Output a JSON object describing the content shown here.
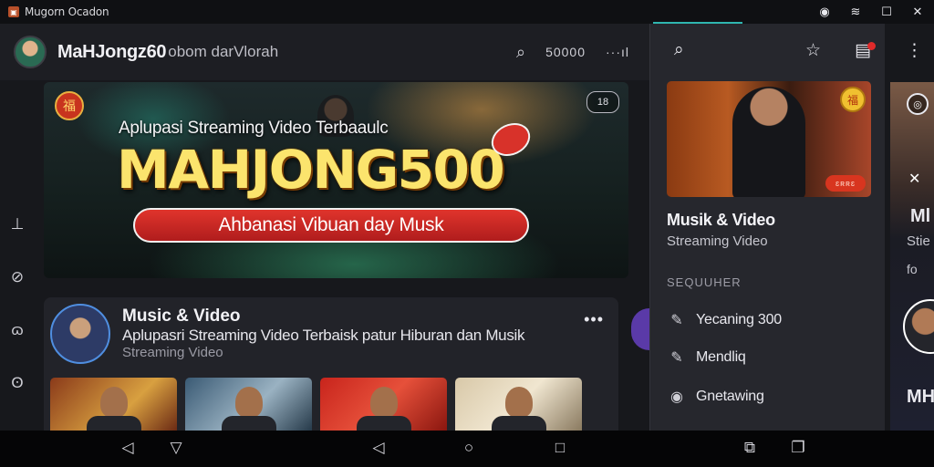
{
  "window": {
    "title": "Mugorn Ocadon",
    "icons": [
      "wifi-icon",
      "signal-icon",
      "maximize-icon",
      "close-icon"
    ]
  },
  "header": {
    "app_name": "MaHJongz60",
    "app_name_suffix": "obom darVlorah",
    "count": "50000",
    "more_label": "···ıl"
  },
  "hero": {
    "tagline": "Aplupasi Streaming Video Terbaaulc",
    "headline": "MAHJONG500",
    "ribbon": "Ahbanasi Vibuan day Musk",
    "corner_badge": "18",
    "left_badge": "福"
  },
  "channel": {
    "title": "Music & Video",
    "description": "Aplupasri Streaming Video Terbaisk patur Hiburan dan Musik",
    "category": "Streaming Video"
  },
  "drawer": {
    "feature_badge": "福",
    "feature_pill": "ɛʀʀɛ",
    "title": "Musik & Video",
    "subtitle": "Streaming Video",
    "section": "SEQUUHER",
    "items": [
      {
        "label": "Yecaning 300",
        "icon": "pen-icon"
      },
      {
        "label": "Mendliq",
        "icon": "pen-icon"
      },
      {
        "label": "Gnetawing",
        "icon": "circle-icon"
      }
    ]
  },
  "peek": {
    "t1": "Ml",
    "t2": "Stie",
    "t3": "fo",
    "t4": "MH"
  },
  "colors": {
    "accent": "#2fb6b0",
    "background": "#17181c",
    "ribbon": "#d62a26",
    "headline": "#fbe46d"
  }
}
